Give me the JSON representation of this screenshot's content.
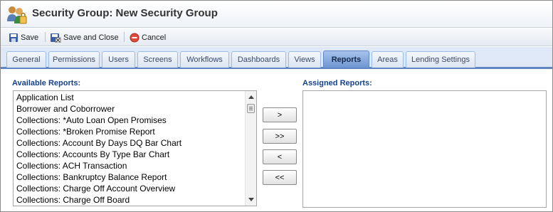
{
  "header": {
    "title": "Security Group: New Security Group",
    "icon": "users-group-icon"
  },
  "toolbar": {
    "save_label": "Save",
    "save_close_label": "Save and Close",
    "cancel_label": "Cancel"
  },
  "tabs": [
    {
      "label": "General"
    },
    {
      "label": "Permissions"
    },
    {
      "label": "Users"
    },
    {
      "label": "Screens"
    },
    {
      "label": "Workflows"
    },
    {
      "label": "Dashboards"
    },
    {
      "label": "Views"
    },
    {
      "label": "Reports",
      "active": true
    },
    {
      "label": "Areas"
    },
    {
      "label": "Lending Settings"
    }
  ],
  "available": {
    "label": "Available Reports:",
    "items": [
      "Application List",
      "Borrower and Coborrower",
      "Collections: *Auto Loan Open Promises",
      "Collections: *Broken Promise Report",
      "Collections: Account By Days DQ Bar Chart",
      "Collections: Accounts By Type Bar Chart",
      "Collections: ACH Transaction",
      "Collections: Bankruptcy Balance Report",
      "Collections: Charge Off Account Overview",
      "Collections: Charge Off Board"
    ]
  },
  "assigned": {
    "label": "Assigned Reports:",
    "items": []
  },
  "buttons": {
    "add": ">",
    "add_all": ">>",
    "remove": "<",
    "remove_all": "<<"
  },
  "colors": {
    "accent": "#5e87c4",
    "label": "#15428b"
  }
}
